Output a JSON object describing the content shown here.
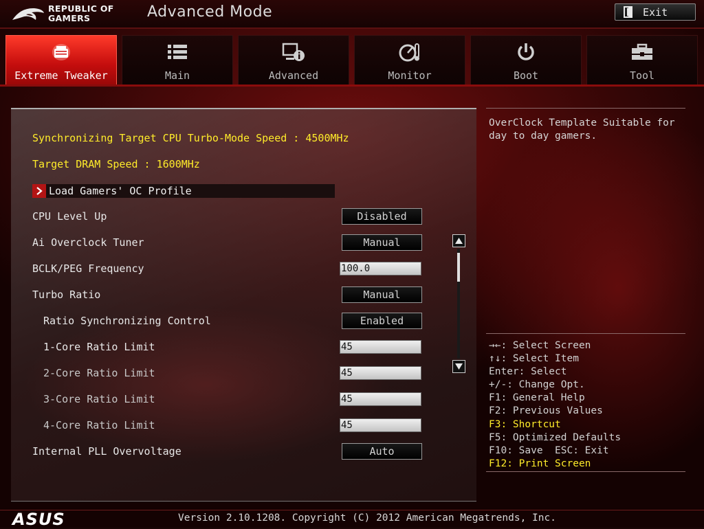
{
  "header": {
    "brand_line1": "REPUBLIC OF",
    "brand_line2": "GAMERS",
    "mode_title": "Advanced Mode",
    "exit_label": "Exit"
  },
  "tabs": [
    {
      "label": "Extreme Tweaker",
      "icon": "tweaker-icon",
      "active": true
    },
    {
      "label": "Main",
      "icon": "list-icon",
      "active": false
    },
    {
      "label": "Advanced",
      "icon": "advanced-info-icon",
      "active": false
    },
    {
      "label": "Monitor",
      "icon": "gauge-icon",
      "active": false
    },
    {
      "label": "Boot",
      "icon": "power-icon",
      "active": false
    },
    {
      "label": "Tool",
      "icon": "toolbox-icon",
      "active": false
    }
  ],
  "settings": {
    "info": [
      "Synchronizing Target CPU Turbo-Mode Speed : 4500MHz",
      "Target DRAM Speed : 1600MHz"
    ],
    "submenu_label": "Load Gamers' OC Profile",
    "items": [
      {
        "label": "CPU Level Up",
        "value": "Disabled"
      },
      {
        "label": "Ai Overclock Tuner",
        "value": "Manual"
      },
      {
        "label": "BCLK/PEG Frequency",
        "value": "100.0"
      },
      {
        "label": "Turbo Ratio",
        "value": "Manual"
      },
      {
        "label": "Ratio Synchronizing Control",
        "value": "Enabled"
      },
      {
        "label": "1-Core Ratio Limit",
        "value": "45"
      },
      {
        "label": "2-Core Ratio Limit",
        "value": "45"
      },
      {
        "label": "3-Core Ratio Limit",
        "value": "45"
      },
      {
        "label": "4-Core Ratio Limit",
        "value": "45"
      },
      {
        "label": "Internal PLL Overvoltage",
        "value": "Auto"
      }
    ]
  },
  "help": {
    "description": "OverClock Template Suitable for day to day gamers.",
    "keys": [
      "→←: Select Screen",
      "↑↓: Select Item",
      "Enter: Select",
      "+/-: Change Opt.",
      "F1: General Help",
      "F2: Previous Values",
      "F3: Shortcut",
      "F5: Optimized Defaults",
      "F10: Save  ESC: Exit",
      "F12: Print Screen"
    ]
  },
  "footer": {
    "brand": "ASUS",
    "version": "Version 2.10.1208. Copyright (C) 2012 American Megatrends, Inc."
  },
  "colors": {
    "accent_red": "#c40d0d",
    "highlight_yellow": "#ffec2a"
  }
}
